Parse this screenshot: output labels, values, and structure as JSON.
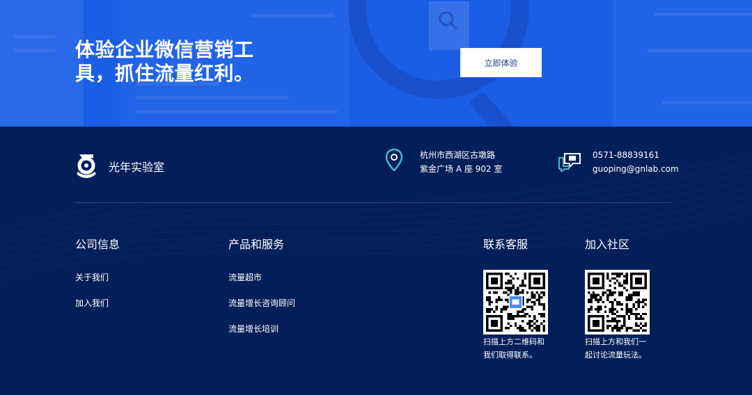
{
  "hero": {
    "title_line1": "体验企业微信营销工",
    "title_line2": "具，抓住流量红利。",
    "cta_label": "立即体验",
    "background_color": "#1a5ee6"
  },
  "brand": {
    "name": "光年实验室",
    "logo_icon": "g-logo-icon"
  },
  "contact": {
    "address_icon": "location-pin-icon",
    "address_line1": "杭州市西湖区古墩路",
    "address_line2": "紫金广场 A 座 902 室",
    "phone_icon": "chat-bubble-icon",
    "phone": "0571-88839161",
    "email": "guoping@gnlab.com"
  },
  "columns": {
    "company": {
      "title": "公司信息",
      "links": [
        "关于我们",
        "加入我们"
      ]
    },
    "products": {
      "title": "产品和服务",
      "links": [
        "流量超市",
        "流量增长咨询顾问",
        "流量增长培训"
      ]
    },
    "support": {
      "title": "联系客服",
      "caption_line1": "扫描上方二维码和",
      "caption_line2": "我们取得联系。"
    },
    "community": {
      "title": "加入社区",
      "caption_line1": "扫描上方和我们一",
      "caption_line2": "起讨论流量玩法。"
    }
  },
  "colors": {
    "footer_bg": "#031f5a",
    "accent_teal": "#4fb8c9"
  }
}
